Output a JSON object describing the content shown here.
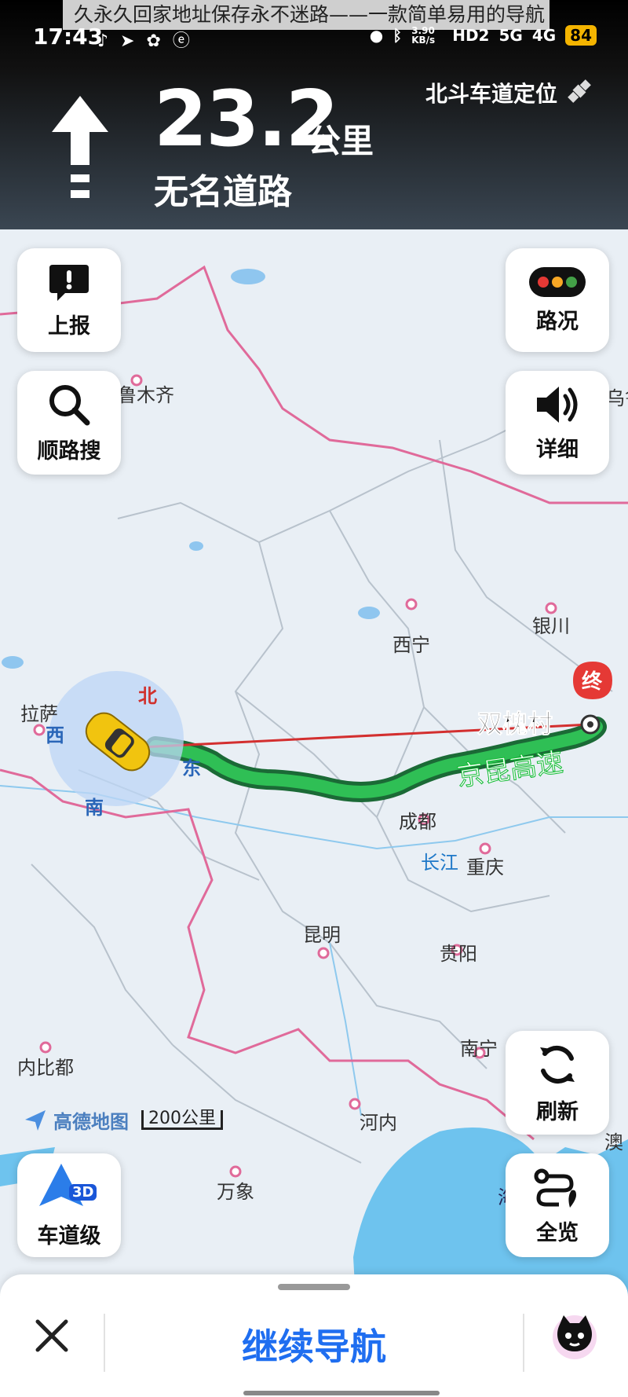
{
  "caption": "久永久回家地址保存永不迷路——一款简单易用的导航 A",
  "status_bar": {
    "time": "17:43",
    "net_speed": "3.90 KB/s",
    "hd": "HD2",
    "sig1": "5G",
    "sig2": "4G",
    "battery": "84"
  },
  "navigation": {
    "distance_value": "23.2",
    "distance_unit": "公里",
    "road_name": "无名道路",
    "positioning": "北斗车道定位"
  },
  "controls": {
    "report": "上报",
    "search_along": "顺路搜",
    "traffic": "路况",
    "detail": "详细",
    "refresh": "刷新",
    "overview": "全览",
    "lane_level": "车道级",
    "lane_badge": "3D"
  },
  "map": {
    "cities": {
      "urumqi": "鲁木齐",
      "xining": "西宁",
      "yinchuan": "银川",
      "lhasa": "拉萨",
      "chengdu": "成都",
      "chongqing": "重庆",
      "kunming": "昆明",
      "guiyang": "贵阳",
      "nanning": "南宁",
      "naypyidaw": "内比都",
      "hanoi": "河内",
      "vientiane": "万象",
      "changjiang": "长江",
      "wulu": "乌鲁",
      "macau": "澳",
      "hai": "海"
    },
    "compass": {
      "n": "北",
      "w": "西",
      "s": "南",
      "e": "东"
    },
    "destination": "双槐村",
    "dest_badge": "终",
    "highway": "京昆高速",
    "brand": "高德地图",
    "scale": "200公里"
  },
  "bottom": {
    "continue": "继续导航"
  },
  "colors": {
    "route": "#2fa84f",
    "accent": "#1f6ef0",
    "header_bg": "#111111",
    "border_red": "#e06a9a",
    "water": "#6ec3ee"
  }
}
